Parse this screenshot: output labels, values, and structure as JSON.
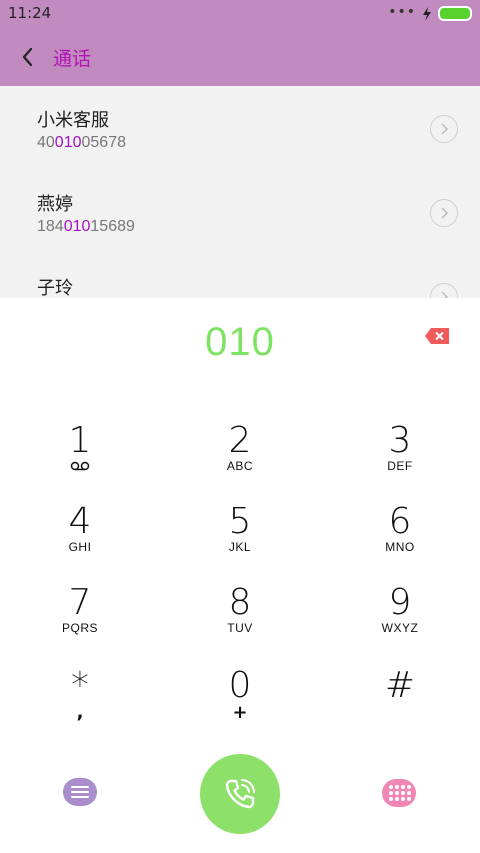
{
  "status_bar": {
    "time": "11:24",
    "dots": "•••"
  },
  "header": {
    "title": "通话"
  },
  "results": [
    {
      "name": "小米客服",
      "number_pre": "40",
      "number_match": "010",
      "number_post": "05678"
    },
    {
      "name": "燕婷",
      "number_pre": "184",
      "number_match": "010",
      "number_post": "15689"
    },
    {
      "name": "子玲",
      "number_pre": "",
      "number_match": "",
      "number_post": ""
    }
  ],
  "dialer": {
    "input_value": "010",
    "keys": [
      {
        "digit": "1",
        "letters": ""
      },
      {
        "digit": "2",
        "letters": "ABC"
      },
      {
        "digit": "3",
        "letters": "DEF"
      },
      {
        "digit": "4",
        "letters": "GHI"
      },
      {
        "digit": "5",
        "letters": "JKL"
      },
      {
        "digit": "6",
        "letters": "MNO"
      },
      {
        "digit": "7",
        "letters": "PQRS"
      },
      {
        "digit": "8",
        "letters": "TUV"
      },
      {
        "digit": "9",
        "letters": "WXYZ"
      },
      {
        "digit": "*",
        "letters": ","
      },
      {
        "digit": "0",
        "letters": "+"
      },
      {
        "digit": "#",
        "letters": ""
      }
    ]
  },
  "colors": {
    "header_bg": "#c28bbf",
    "title": "#b312b7",
    "match_highlight": "#a113c6",
    "dial_input": "#7ee264",
    "call_button": "#8de06a",
    "backspace": "#f05a5a",
    "menu_button": "#a98dcf",
    "keypad_toggle": "#ef86b3"
  },
  "icons": {
    "back": "chevron-left-icon",
    "detail": "chevron-right-circle-icon",
    "backspace": "backspace-icon",
    "voicemail": "voicemail-icon",
    "call": "phone-icon",
    "menu": "menu-icon",
    "keypad": "keypad-grid-icon"
  }
}
